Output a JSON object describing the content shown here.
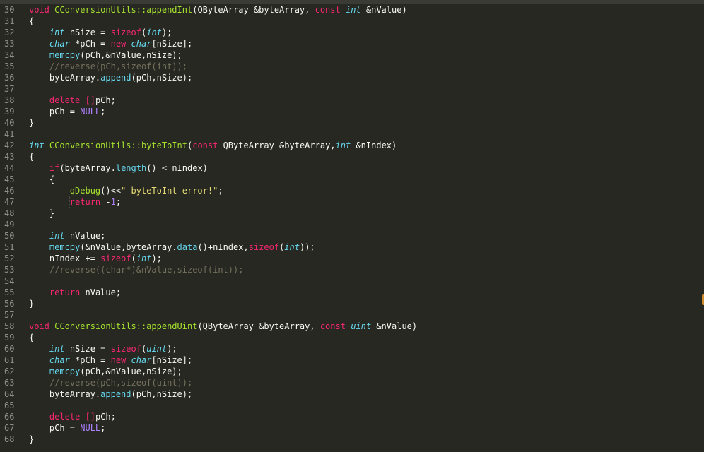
{
  "editor": {
    "guides": [
      {
        "line": 30,
        "span": 8
      },
      {
        "line": 42,
        "span": 13
      },
      {
        "line": 45,
        "span": 1
      },
      {
        "line": 58,
        "span": 8
      }
    ],
    "lines": [
      {
        "no": "30",
        "tokens": [
          [
            "kw",
            "void"
          ],
          [
            "txt",
            " "
          ],
          [
            "fn",
            "CConversionUtils::appendInt"
          ],
          [
            "txt",
            "(QByteArray &byteArray, "
          ],
          [
            "kw",
            "const"
          ],
          [
            "txt",
            " "
          ],
          [
            "type",
            "int"
          ],
          [
            "txt",
            " &nValue)"
          ]
        ]
      },
      {
        "no": "31",
        "tokens": [
          [
            "txt",
            "{"
          ]
        ]
      },
      {
        "no": "32",
        "tokens": [
          [
            "txt",
            "    "
          ],
          [
            "type",
            "int"
          ],
          [
            "txt",
            " nSize = "
          ],
          [
            "kw",
            "sizeof"
          ],
          [
            "txt",
            "("
          ],
          [
            "type",
            "int"
          ],
          [
            "txt",
            ");"
          ]
        ]
      },
      {
        "no": "33",
        "tokens": [
          [
            "txt",
            "    "
          ],
          [
            "type",
            "char"
          ],
          [
            "txt",
            " *pCh = "
          ],
          [
            "kw",
            "new"
          ],
          [
            "txt",
            " "
          ],
          [
            "type",
            "char"
          ],
          [
            "txt",
            "[nSize];"
          ]
        ]
      },
      {
        "no": "34",
        "tokens": [
          [
            "txt",
            "    "
          ],
          [
            "call",
            "memcpy"
          ],
          [
            "txt",
            "(pCh,&nValue,nSize);"
          ]
        ]
      },
      {
        "no": "35",
        "tokens": [
          [
            "txt",
            "    "
          ],
          [
            "com",
            "//reverse(pCh,sizeof(int));"
          ]
        ]
      },
      {
        "no": "36",
        "tokens": [
          [
            "txt",
            "    byteArray."
          ],
          [
            "call",
            "append"
          ],
          [
            "txt",
            "(pCh,nSize);"
          ]
        ]
      },
      {
        "no": "37",
        "tokens": []
      },
      {
        "no": "38",
        "tokens": [
          [
            "txt",
            "    "
          ],
          [
            "kw",
            "delete"
          ],
          [
            "txt",
            " "
          ],
          [
            "kw",
            "[]"
          ],
          [
            "txt",
            "pCh;"
          ]
        ]
      },
      {
        "no": "39",
        "tokens": [
          [
            "txt",
            "    pCh = "
          ],
          [
            "num",
            "NULL"
          ],
          [
            "txt",
            ";"
          ]
        ]
      },
      {
        "no": "40",
        "tokens": [
          [
            "txt",
            "}"
          ]
        ]
      },
      {
        "no": "41",
        "tokens": []
      },
      {
        "no": "42",
        "tokens": [
          [
            "type",
            "int"
          ],
          [
            "txt",
            " "
          ],
          [
            "fn",
            "CConversionUtils::byteToInt"
          ],
          [
            "txt",
            "("
          ],
          [
            "kw",
            "const"
          ],
          [
            "txt",
            " QByteArray &byteArray,"
          ],
          [
            "type",
            "int"
          ],
          [
            "txt",
            " &nIndex)"
          ]
        ]
      },
      {
        "no": "43",
        "tokens": [
          [
            "txt",
            "{"
          ]
        ]
      },
      {
        "no": "44",
        "tokens": [
          [
            "txt",
            "    "
          ],
          [
            "kw",
            "if"
          ],
          [
            "txt",
            "(byteArray."
          ],
          [
            "call",
            "length"
          ],
          [
            "txt",
            "() < nIndex)"
          ]
        ]
      },
      {
        "no": "45",
        "tokens": [
          [
            "txt",
            "    {"
          ]
        ]
      },
      {
        "no": "46",
        "tokens": [
          [
            "txt",
            "        "
          ],
          [
            "fn",
            "qDebug"
          ],
          [
            "txt",
            "()<<"
          ],
          [
            "str",
            "\" byteToInt error!\""
          ],
          [
            "txt",
            ";"
          ]
        ]
      },
      {
        "no": "47",
        "tokens": [
          [
            "txt",
            "        "
          ],
          [
            "kw",
            "return"
          ],
          [
            "txt",
            " -"
          ],
          [
            "num",
            "1"
          ],
          [
            "txt",
            ";"
          ]
        ]
      },
      {
        "no": "48",
        "tokens": [
          [
            "txt",
            "    }"
          ]
        ]
      },
      {
        "no": "49",
        "tokens": []
      },
      {
        "no": "50",
        "tokens": [
          [
            "txt",
            "    "
          ],
          [
            "type",
            "int"
          ],
          [
            "txt",
            " nValue;"
          ]
        ]
      },
      {
        "no": "51",
        "tokens": [
          [
            "txt",
            "    "
          ],
          [
            "call",
            "memcpy"
          ],
          [
            "txt",
            "(&nValue,byteArray."
          ],
          [
            "call",
            "data"
          ],
          [
            "txt",
            "()+nIndex,"
          ],
          [
            "kw",
            "sizeof"
          ],
          [
            "txt",
            "("
          ],
          [
            "type",
            "int"
          ],
          [
            "txt",
            "));"
          ]
        ]
      },
      {
        "no": "52",
        "tokens": [
          [
            "txt",
            "    nIndex += "
          ],
          [
            "kw",
            "sizeof"
          ],
          [
            "txt",
            "("
          ],
          [
            "type",
            "int"
          ],
          [
            "txt",
            ");"
          ]
        ]
      },
      {
        "no": "53",
        "tokens": [
          [
            "txt",
            "    "
          ],
          [
            "com",
            "//reverse((char*)&nValue,sizeof(int));"
          ]
        ]
      },
      {
        "no": "54",
        "tokens": []
      },
      {
        "no": "55",
        "tokens": [
          [
            "txt",
            "    "
          ],
          [
            "kw",
            "return"
          ],
          [
            "txt",
            " nValue;"
          ]
        ]
      },
      {
        "no": "56",
        "tokens": [
          [
            "txt",
            "}"
          ]
        ]
      },
      {
        "no": "57",
        "tokens": []
      },
      {
        "no": "58",
        "tokens": [
          [
            "kw",
            "void"
          ],
          [
            "txt",
            " "
          ],
          [
            "fn",
            "CConversionUtils::appendUint"
          ],
          [
            "txt",
            "(QByteArray &byteArray, "
          ],
          [
            "kw",
            "const"
          ],
          [
            "txt",
            " "
          ],
          [
            "type",
            "uint"
          ],
          [
            "txt",
            " &nValue)"
          ]
        ]
      },
      {
        "no": "59",
        "tokens": [
          [
            "txt",
            "{"
          ]
        ]
      },
      {
        "no": "60",
        "tokens": [
          [
            "txt",
            "    "
          ],
          [
            "type",
            "int"
          ],
          [
            "txt",
            " nSize = "
          ],
          [
            "kw",
            "sizeof"
          ],
          [
            "txt",
            "("
          ],
          [
            "type",
            "uint"
          ],
          [
            "txt",
            ");"
          ]
        ]
      },
      {
        "no": "61",
        "tokens": [
          [
            "txt",
            "    "
          ],
          [
            "type",
            "char"
          ],
          [
            "txt",
            " *pCh = "
          ],
          [
            "kw",
            "new"
          ],
          [
            "txt",
            " "
          ],
          [
            "type",
            "char"
          ],
          [
            "txt",
            "[nSize];"
          ]
        ]
      },
      {
        "no": "62",
        "tokens": [
          [
            "txt",
            "    "
          ],
          [
            "call",
            "memcpy"
          ],
          [
            "txt",
            "(pCh,&nValue,nSize);"
          ]
        ]
      },
      {
        "no": "63",
        "tokens": [
          [
            "txt",
            "    "
          ],
          [
            "com",
            "//reverse(pCh,sizeof(uint));"
          ]
        ]
      },
      {
        "no": "64",
        "tokens": [
          [
            "txt",
            "    byteArray."
          ],
          [
            "call",
            "append"
          ],
          [
            "txt",
            "(pCh,nSize);"
          ]
        ]
      },
      {
        "no": "65",
        "tokens": []
      },
      {
        "no": "66",
        "tokens": [
          [
            "txt",
            "    "
          ],
          [
            "kw",
            "delete"
          ],
          [
            "txt",
            " "
          ],
          [
            "kw",
            "[]"
          ],
          [
            "txt",
            "pCh;"
          ]
        ]
      },
      {
        "no": "67",
        "tokens": [
          [
            "txt",
            "    pCh = "
          ],
          [
            "num",
            "NULL"
          ],
          [
            "txt",
            ";"
          ]
        ]
      },
      {
        "no": "68",
        "tokens": [
          [
            "txt",
            "}"
          ]
        ]
      }
    ]
  }
}
